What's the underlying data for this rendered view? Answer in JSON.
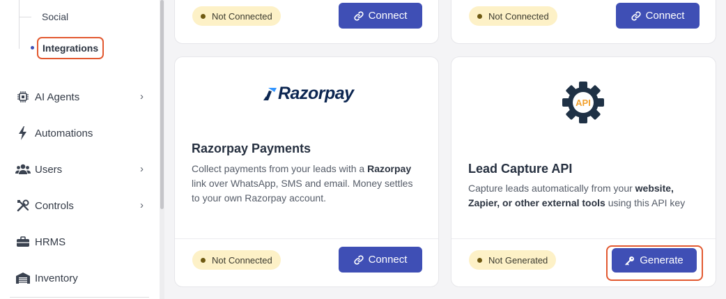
{
  "sidebar": {
    "sub_items": {
      "social": "Social",
      "integrations": "Integrations"
    },
    "items": [
      {
        "label": "AI Agents",
        "icon": "chip-icon",
        "has_chevron": true
      },
      {
        "label": "Automations",
        "icon": "bolt-icon",
        "has_chevron": false
      },
      {
        "label": "Users",
        "icon": "users-icon",
        "has_chevron": true
      },
      {
        "label": "Controls",
        "icon": "tools-icon",
        "has_chevron": true
      },
      {
        "label": "HRMS",
        "icon": "briefcase-icon",
        "has_chevron": false
      },
      {
        "label": "Inventory",
        "icon": "warehouse-icon",
        "has_chevron": false
      }
    ],
    "chevron": "›"
  },
  "cards": {
    "top_left": {
      "badge": "Not Connected",
      "button": "Connect"
    },
    "top_right": {
      "badge": "Not Connected",
      "button": "Connect"
    },
    "razorpay": {
      "logo_text": "Razorpay",
      "title": "Razorpay Payments",
      "desc_pre": "Collect payments from your leads with a ",
      "desc_bold": "Razorpay",
      "desc_post": " link over WhatsApp, SMS and email. Money settles to your own Razorpay account.",
      "badge": "Not Connected",
      "button": "Connect"
    },
    "lead_api": {
      "icon_text": "API",
      "title": "Lead Capture API",
      "desc_pre": "Capture leads automatically from your ",
      "desc_bold": "website, Zapier, or other external tools",
      "desc_post": " using this API key",
      "badge": "Not Generated",
      "button": "Generate"
    }
  },
  "colors": {
    "primary": "#3f4fb5",
    "badge_bg": "#fdf1c7",
    "highlight": "#e2582f",
    "api_icon": "#1f3145",
    "api_text": "#f2a12e"
  }
}
